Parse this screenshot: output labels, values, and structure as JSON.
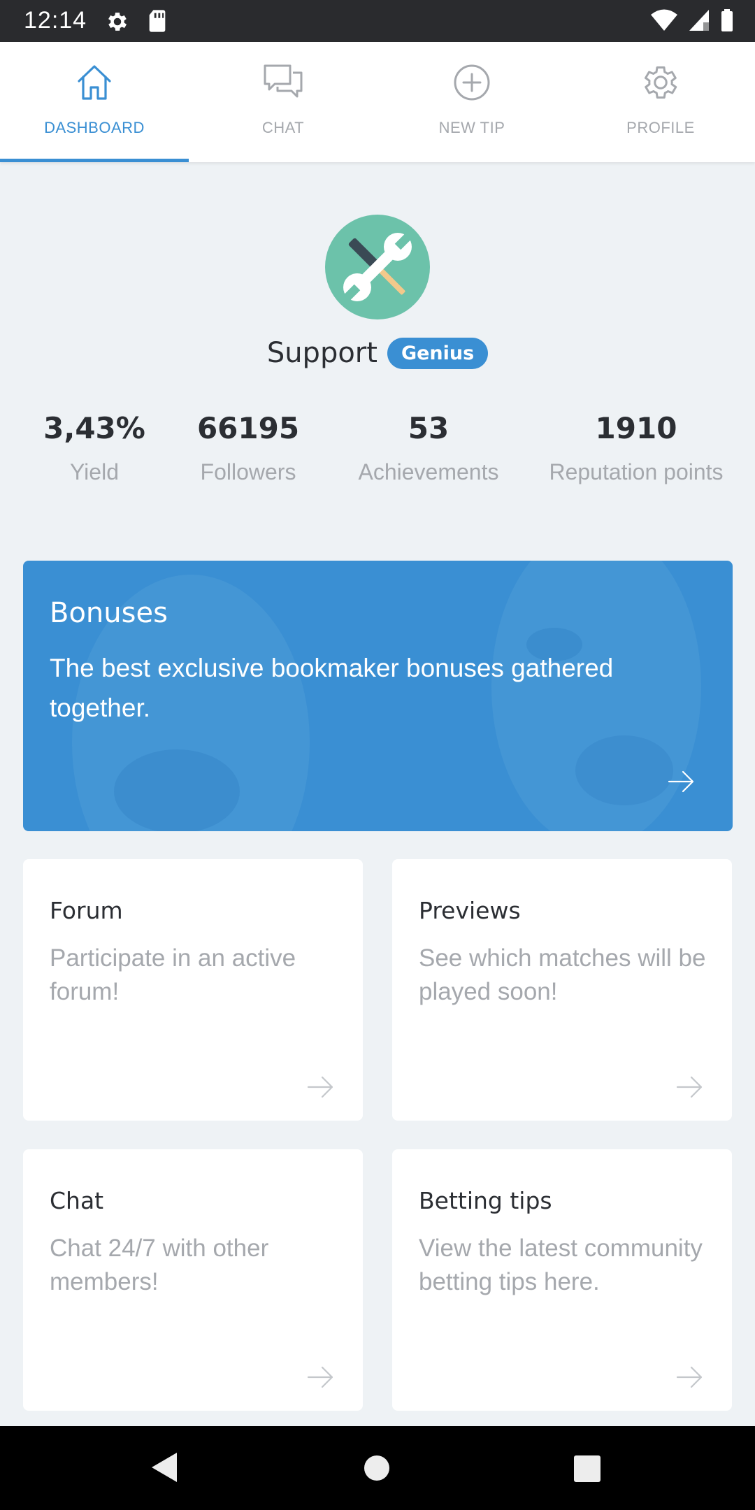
{
  "status_bar": {
    "time": "12:14"
  },
  "tabs": [
    {
      "label": "DASHBOARD",
      "icon": "home-icon",
      "active": true
    },
    {
      "label": "CHAT",
      "icon": "chat-bubbles-icon",
      "active": false
    },
    {
      "label": "NEW TIP",
      "icon": "plus-circle-icon",
      "active": false
    },
    {
      "label": "PROFILE",
      "icon": "gear-icon",
      "active": false
    }
  ],
  "profile": {
    "name": "Support",
    "rank": "Genius",
    "avatar_icon": "tools-icon"
  },
  "stats": [
    {
      "value": "3,43%",
      "label": "Yield"
    },
    {
      "value": "66195",
      "label": "Followers"
    },
    {
      "value": "53",
      "label": "Achievements"
    },
    {
      "value": "1910",
      "label": "Reputation points"
    }
  ],
  "banner": {
    "title": "Bonuses",
    "description": "The best exclusive bookmaker bonuses gathered together."
  },
  "cards": [
    {
      "title": "Forum",
      "description": "Participate in an active forum!"
    },
    {
      "title": "Previews",
      "description": "See which matches will be played soon!"
    },
    {
      "title": "Chat",
      "description": "Chat 24/7 with other members!"
    },
    {
      "title": "Betting tips",
      "description": "View the latest community betting tips here."
    }
  ],
  "colors": {
    "accent": "#3a8fd3",
    "background": "#eef2f5",
    "muted_text": "#a5a8ad",
    "dark_text": "#2b2e33",
    "avatar_bg": "#6cc2aa"
  }
}
